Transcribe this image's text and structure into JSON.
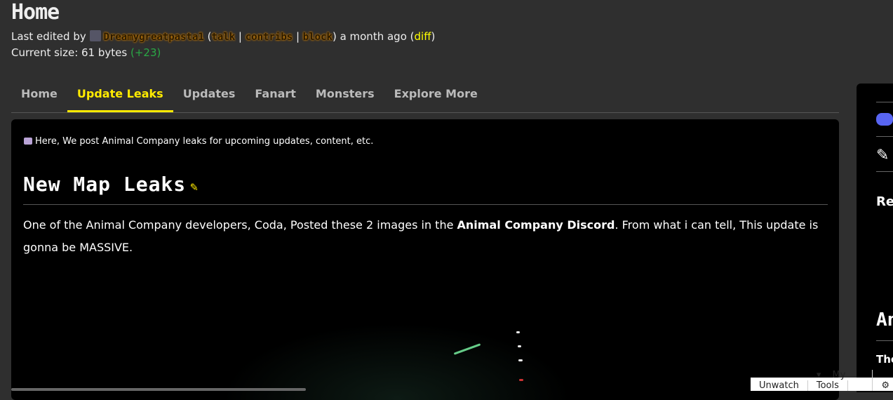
{
  "page": {
    "title": "Home"
  },
  "meta": {
    "last_edited_prefix": "Last edited by",
    "user": "Dreamygreatpasta1",
    "talk": "talk",
    "contribs": "contribs",
    "block": "block",
    "time": "a month ago",
    "diff": "diff",
    "size_label": "Current size: 61 bytes",
    "size_delta": "(+23)"
  },
  "tabs": [
    {
      "label": "Home"
    },
    {
      "label": "Update Leaks"
    },
    {
      "label": "Updates"
    },
    {
      "label": "Fanart"
    },
    {
      "label": "Monsters"
    },
    {
      "label": "Explore More"
    }
  ],
  "content": {
    "intro": "Here, We post Animal Company leaks for upcoming updates, content, etc.",
    "heading": "New Map Leaks",
    "para_a": "One of the Animal Company developers, Coda, Posted these 2 images in the ",
    "para_bold": "Animal Company Discord",
    "para_b": ". From what i can tell, This update is gonna be MASSIVE."
  },
  "rail": {
    "re": "Re",
    "an": "An",
    "the": "The"
  },
  "bottombar": {
    "unwatch": "Unwatch",
    "my_tools": "My Tools"
  },
  "colors": {
    "accent": "#ffeb00",
    "positive": "#2aa845",
    "discord": "#5865f2"
  }
}
